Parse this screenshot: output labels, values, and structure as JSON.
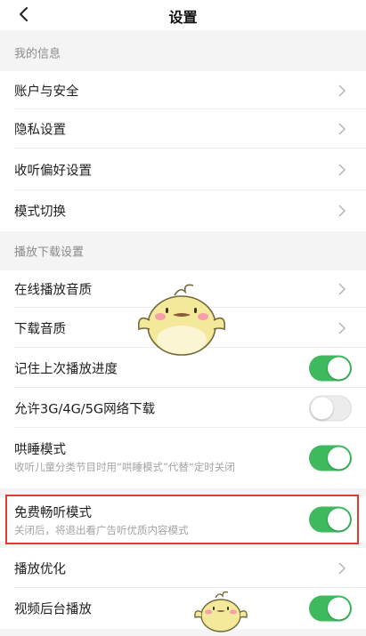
{
  "navbar": {
    "title": "设置",
    "back_icon": "chevron-left-icon"
  },
  "sections": {
    "my_info": {
      "header": "我的信息"
    },
    "playback_download": {
      "header": "播放下载设置"
    }
  },
  "rows": {
    "account_security": {
      "label": "账户与安全",
      "control": "chevron"
    },
    "privacy": {
      "label": "隐私设置",
      "control": "chevron"
    },
    "listening_preferences": {
      "label": "收听偏好设置",
      "control": "chevron"
    },
    "mode_switch": {
      "label": "模式切换",
      "control": "chevron"
    },
    "online_quality": {
      "label": "在线播放音质",
      "control": "chevron"
    },
    "download_quality": {
      "label": "下载音质",
      "control": "chevron"
    },
    "remember_progress": {
      "label": "记住上次播放进度",
      "control": "toggle",
      "enabled": true
    },
    "network_download": {
      "label": "允许3G/4G/5G网络下载",
      "control": "toggle",
      "enabled": false
    },
    "lullaby_mode": {
      "label": "哄睡模式",
      "sublabel": "收听儿童分类节目时用“哄睡模式”代替“定时关闭",
      "control": "toggle",
      "enabled": true
    },
    "free_listen_mode": {
      "label": "免费畅听模式",
      "sublabel": "关闭后，将退出看广告听优质内容模式",
      "control": "toggle",
      "enabled": true
    },
    "playback_optimization": {
      "label": "播放优化",
      "control": "chevron"
    },
    "video_background": {
      "label": "视频后台播放",
      "control": "toggle",
      "enabled": true
    }
  },
  "colors": {
    "toggle_on": "#3eb95d",
    "toggle_off": "#ececec",
    "highlight": "#e23a2f",
    "section_text": "#8a8a8a",
    "mascot_body": "#f4e89b"
  },
  "decorations": {
    "highlight_target": "free_listen_mode",
    "mascots": [
      "chick-mascot-sticker",
      "chick-mascot-small"
    ]
  }
}
